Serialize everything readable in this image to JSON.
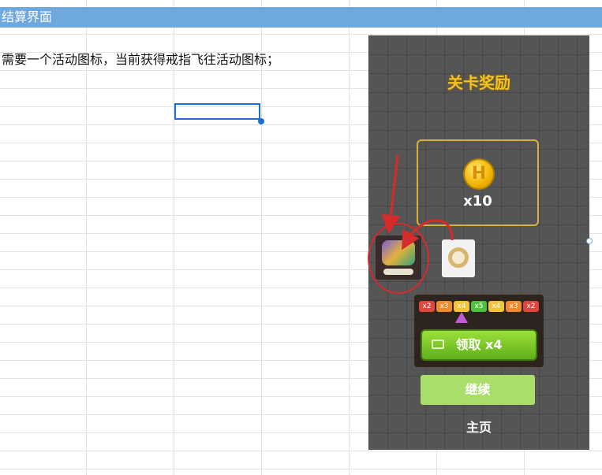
{
  "sheet": {
    "header_title": "结算界面",
    "note_text": "需要一个活动图标，当前获得戒指飞往活动图标；"
  },
  "game": {
    "title": "关卡奖励",
    "coin_symbol": "H",
    "coin_count": "x10",
    "multipliers": [
      "x2",
      "x3",
      "x4",
      "x5",
      "x4",
      "x3",
      "x2"
    ],
    "multiplier_colors": [
      "#e0463c",
      "#f08a2a",
      "#f5c23a",
      "#4cc23a",
      "#f5c23a",
      "#f08a2a",
      "#e0463c"
    ],
    "claim_label": "领取 x4",
    "continue_label": "继续",
    "home_label": "主页"
  },
  "colors": {
    "header_bg": "#6fa8dc",
    "selection": "#1a6fd6",
    "annotation_red": "#d62b2b"
  }
}
